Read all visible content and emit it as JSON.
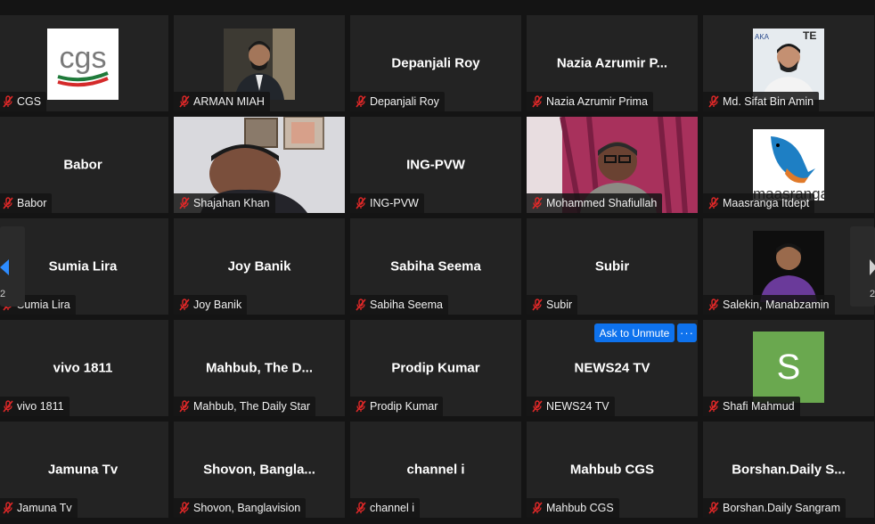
{
  "tiles": [
    {
      "name": "CGS",
      "label": "CGS",
      "type": "logo-cgs"
    },
    {
      "name": "ARMAN MIAH",
      "label": "ARMAN MIAH",
      "type": "photo-arman"
    },
    {
      "name": "Depanjali Roy",
      "label": "Depanjali Roy",
      "type": "text"
    },
    {
      "name": "Nazia Azrumir P...",
      "label": "Nazia Azrumir Prima",
      "type": "text"
    },
    {
      "name": "Md. Sifat Bin Amin",
      "label": "Md. Sifat Bin Amin",
      "type": "photo-sifat"
    },
    {
      "name": "Babor",
      "label": "Babor",
      "type": "text"
    },
    {
      "name": "Shajahan Khan",
      "label": "Shajahan Khan",
      "type": "video-shajahan"
    },
    {
      "name": "ING-PVW",
      "label": "ING-PVW",
      "type": "text"
    },
    {
      "name": "Mohammed Shafiullah",
      "label": "Mohammed Shafiullah",
      "type": "video-shafiullah"
    },
    {
      "name": "Maasranga Itdept",
      "label": "Maasranga Itdept",
      "type": "logo-maasranga"
    },
    {
      "name": "Sumia Lira",
      "label": "Sumia Lira",
      "type": "text"
    },
    {
      "name": "Joy Banik",
      "label": "Joy Banik",
      "type": "text"
    },
    {
      "name": "Sabiha Seema",
      "label": "Sabiha Seema",
      "type": "text"
    },
    {
      "name": "Subir",
      "label": "Subir",
      "type": "text"
    },
    {
      "name": "Salekin, Manabzamin",
      "label": "Salekin, Manabzamin",
      "type": "photo-salekin"
    },
    {
      "name": "vivo 1811",
      "label": "vivo 1811",
      "type": "text"
    },
    {
      "name": "Mahbub,  The D...",
      "label": "Mahbub, The Daily Star",
      "type": "text"
    },
    {
      "name": "Prodip Kumar",
      "label": "Prodip Kumar",
      "type": "text"
    },
    {
      "name": "NEWS24 TV",
      "label": "NEWS24 TV",
      "type": "text"
    },
    {
      "name": "Shafi Mahmud",
      "label": "Shafi Mahmud",
      "type": "letter",
      "letter": "S"
    },
    {
      "name": "Jamuna Tv",
      "label": "Jamuna Tv",
      "type": "text"
    },
    {
      "name": "Shovon,  Bangla...",
      "label": "Shovon, Banglavision",
      "type": "text"
    },
    {
      "name": "channel i",
      "label": "channel i",
      "type": "text"
    },
    {
      "name": "Mahbub CGS",
      "label": "Mahbub CGS",
      "type": "text"
    },
    {
      "name": "Borshan.Daily  S...",
      "label": "Borshan.Daily Sangram",
      "type": "text"
    }
  ],
  "logos": {
    "cgs": "cgs",
    "maasranga": "maasranga"
  },
  "controls": {
    "ask_to_unmute": "Ask to Unmute",
    "more": "···"
  },
  "nav": {
    "left_page": "2",
    "right_page": "2"
  },
  "colors": {
    "background": "#141414",
    "tile": "#232323",
    "mic_muted": "#e02828",
    "accent": "#0e72ed",
    "avatar_green": "#6aa84f"
  }
}
